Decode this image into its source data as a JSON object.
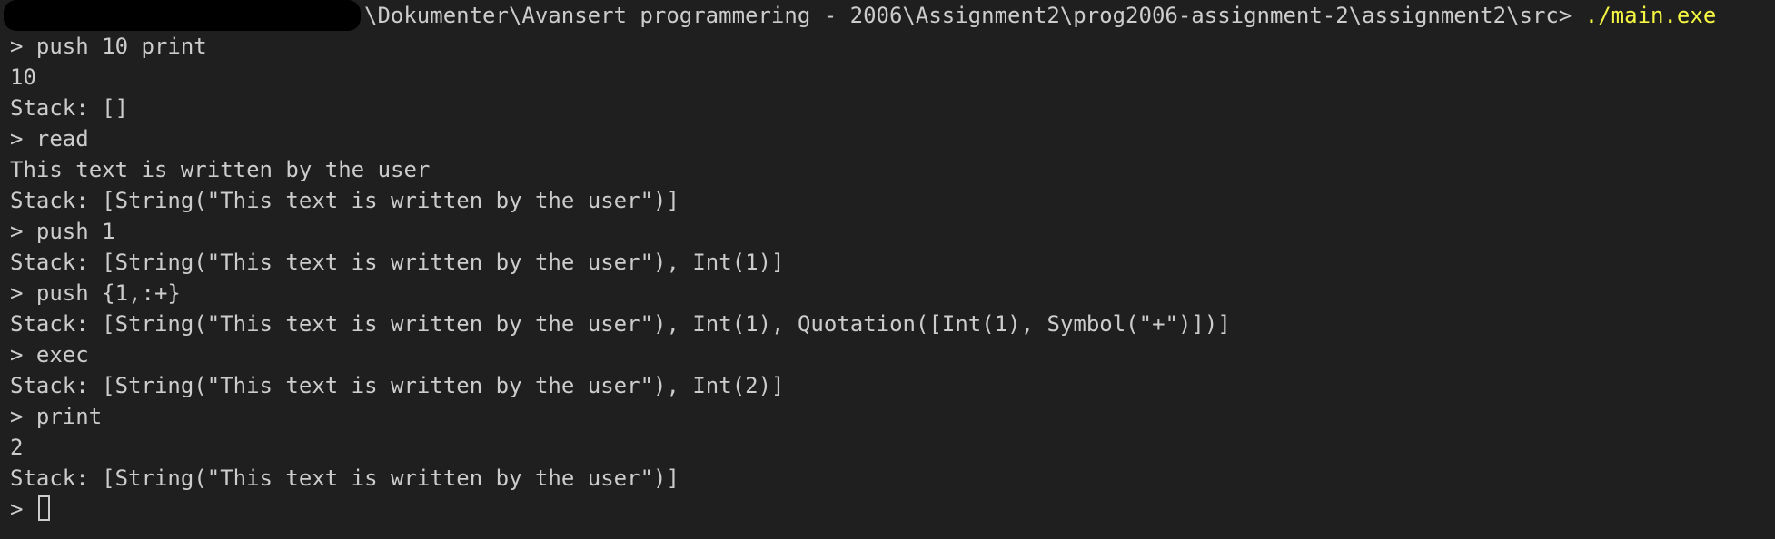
{
  "terminal": {
    "prompt_path": "\\Dokumenter\\Avansert programmering - 2006\\Assignment2\\prog2006-assignment-2\\assignment2\\src>",
    "command": "./main.exe",
    "lines": [
      "> push 10 print",
      "10",
      "Stack: []",
      "> read",
      "This text is written by the user",
      "Stack: [String(\"This text is written by the user\")]",
      "> push 1",
      "Stack: [String(\"This text is written by the user\"), Int(1)]",
      "> push {1,:+}",
      "Stack: [String(\"This text is written by the user\"), Int(1), Quotation([Int(1), Symbol(\"+\")])]",
      "> exec",
      "Stack: [String(\"This text is written by the user\"), Int(2)]",
      "> print",
      "2",
      "Stack: [String(\"This text is written by the user\")]"
    ],
    "input_prompt": ">",
    "colors": {
      "background": "#1f1f1f",
      "text": "#cccccc",
      "command": "#f5f543"
    }
  }
}
